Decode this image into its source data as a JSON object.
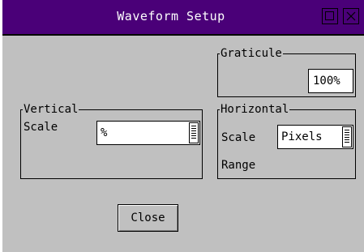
{
  "window": {
    "title": "Waveform Setup"
  },
  "graticule": {
    "legend": "Graticule",
    "value": "100%"
  },
  "vertical": {
    "legend": "Vertical",
    "scale_label": "Scale",
    "scale_value": "%"
  },
  "horizontal": {
    "legend": "Horizontal",
    "scale_label": "Scale",
    "scale_value": "Pixels",
    "range_label": "Range"
  },
  "buttons": {
    "close_label": "Close"
  },
  "icons": {
    "maximize": "maximize-icon",
    "close": "close-icon",
    "dropdown": "list-dropdown-icon"
  },
  "colors": {
    "titlebar": "#4a0078",
    "title_text": "#ffffff",
    "background": "#c0c0c0"
  }
}
